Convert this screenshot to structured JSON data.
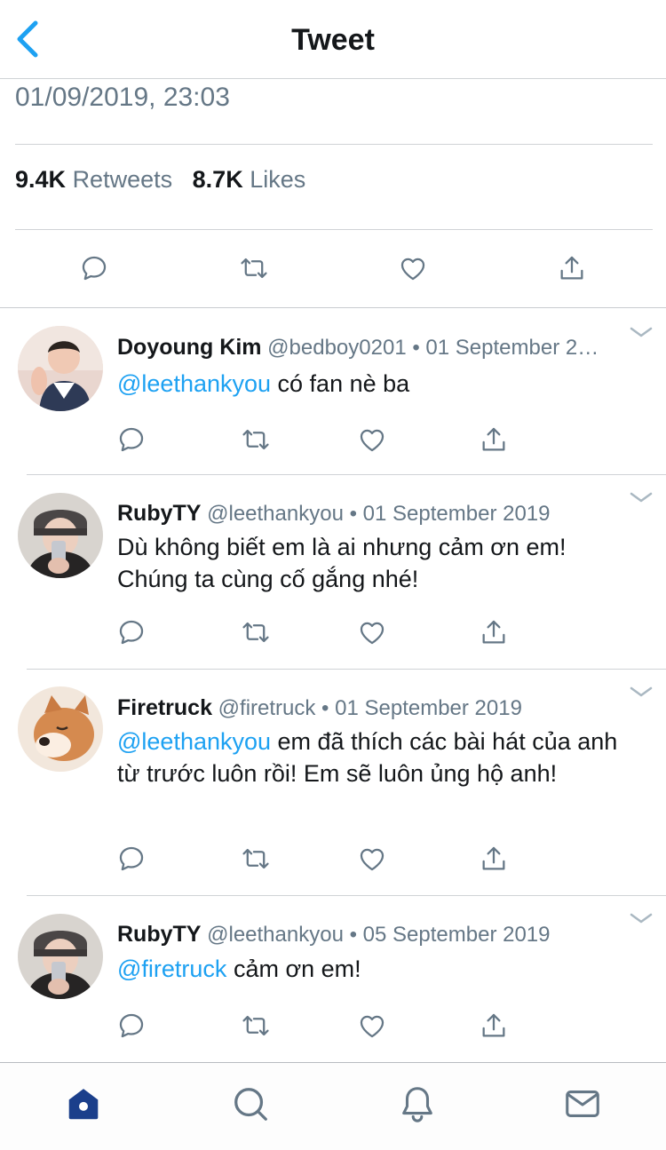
{
  "header": {
    "title": "Tweet",
    "back_icon": "chevron-left-icon"
  },
  "tweet": {
    "timestamp": "01/09/2019, 23:03",
    "retweets_count": "9.4K",
    "retweets_label": "Retweets",
    "likes_count": "8.7K",
    "likes_label": "Likes"
  },
  "actions": [
    "reply-icon",
    "retweet-icon",
    "like-icon",
    "share-icon"
  ],
  "replies": [
    {
      "name": "Doyoung Kim",
      "handle": "@bedboy0201",
      "date": "01 September 2…",
      "mention": "@leethankyou",
      "text": " có fan nè ba"
    },
    {
      "name": "RubyTY",
      "handle": "@leethankyou",
      "date": "01 September 2019",
      "mention": "",
      "text": "Dù không biết em là ai nhưng cảm ơn em! Chúng ta cùng cố gắng nhé!"
    },
    {
      "name": "Firetruck",
      "handle": "@firetruck",
      "date": "01 September 2019",
      "mention": "@leethankyou",
      "text": " em đã thích các bài hát của anh từ trước luôn rồi! Em sẽ luôn ủng hộ anh!"
    },
    {
      "name": "RubyTY",
      "handle": "@leethankyou",
      "date": "05 September 2019",
      "mention": "@firetruck",
      "text": " cảm ơn em!"
    }
  ],
  "separator": " • ",
  "tabbar": [
    "home-icon",
    "search-icon",
    "notifications-icon",
    "messages-icon"
  ],
  "colors": {
    "accent": "#1da1f2",
    "secondary_text": "#657786",
    "active_tab": "#1b3f8b",
    "icon_gray": "#657786"
  }
}
